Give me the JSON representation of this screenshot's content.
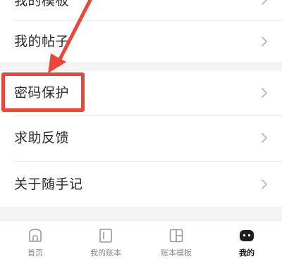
{
  "menu": {
    "items": [
      {
        "label": "我的模板"
      },
      {
        "label": "我的帖子"
      },
      {
        "label": "密码保护"
      },
      {
        "label": "求助反馈"
      },
      {
        "label": "关于随手记"
      }
    ]
  },
  "tabbar": {
    "tabs": [
      {
        "label": "首页",
        "icon": "home-icon"
      },
      {
        "label": "我的账本",
        "icon": "book-icon"
      },
      {
        "label": "账本模板",
        "icon": "template-icon"
      },
      {
        "label": "我的",
        "icon": "profile-icon",
        "active": true
      }
    ]
  },
  "colors": {
    "highlight": "#e8473a",
    "background_gap": "#f4f4f4",
    "chevron": "#b8b8b8"
  }
}
